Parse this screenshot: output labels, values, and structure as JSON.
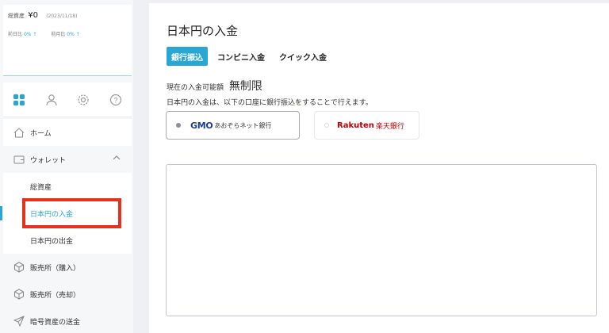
{
  "summary": {
    "label": "総資産",
    "amount": "¥0",
    "date": "(2023/11/18)",
    "prev_day_label": "前日比",
    "prev_day_pct": "0% ↑",
    "prev_month_label": "前月比",
    "prev_month_pct": "0% ↑"
  },
  "icon_tabs": [
    "grid-icon",
    "user-icon",
    "gear-icon",
    "help-icon"
  ],
  "sidebar": {
    "items": [
      {
        "label": "ホーム",
        "icon": "home-icon"
      },
      {
        "label": "ウォレット",
        "icon": "wallet-icon"
      },
      {
        "label": "総資産"
      },
      {
        "label": "日本円の入金"
      },
      {
        "label": "日本円の出金"
      },
      {
        "label": "販売所（購入）",
        "icon": "cube-icon"
      },
      {
        "label": "販売所（売却）",
        "icon": "cube-icon"
      },
      {
        "label": "暗号資産の送金",
        "icon": "send-icon"
      }
    ]
  },
  "main": {
    "title": "日本円の入金",
    "tabs": [
      {
        "label": "銀行振込"
      },
      {
        "label": "コンビニ入金"
      },
      {
        "label": "クイック入金"
      }
    ],
    "limit_label": "現在の入金可能額",
    "limit_value": "無制限",
    "description": "日本円の入金は、以下の口座に銀行振込をすることで行えます。",
    "banks": [
      {
        "logo": "GMO",
        "name": "あおぞらネット銀行"
      },
      {
        "logo": "Rakuten",
        "name": "楽天銀行"
      }
    ]
  },
  "colors": {
    "accent": "#2aa6d4",
    "highlight": "#e8301c",
    "rakuten": "#bf0000",
    "gmo": "#1a3e8c"
  }
}
